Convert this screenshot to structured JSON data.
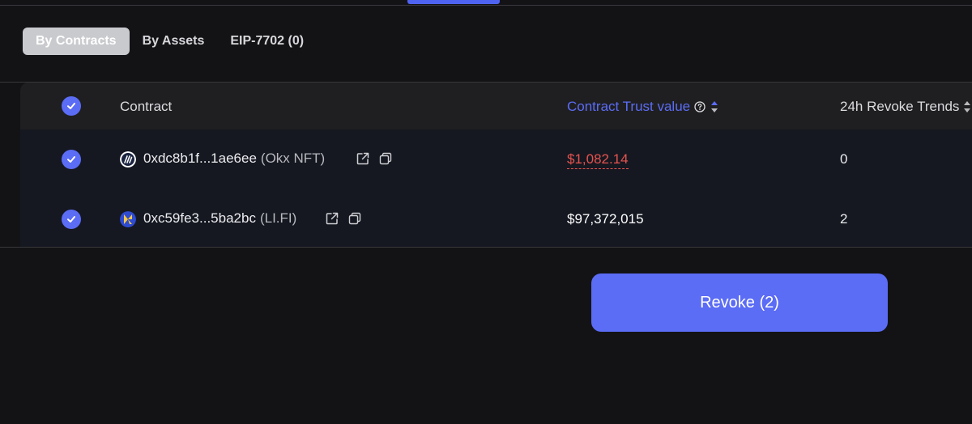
{
  "tabs": [
    {
      "label": "By Contracts",
      "active": true
    },
    {
      "label": "By Assets",
      "active": false
    },
    {
      "label": "EIP-7702 (0)",
      "active": false
    }
  ],
  "table": {
    "headers": {
      "contract": "Contract",
      "trust_value": "Contract Trust value",
      "revoke_trends": "24h Revoke Trends"
    },
    "rows": [
      {
        "checked": true,
        "address": "0xdc8b1f...1ae6ee",
        "tag": "(Okx NFT)",
        "trust_value": "$1,082.14",
        "trust_value_color": "#e6534f",
        "revoke_trend": "0",
        "logo_icon": "okx-nft-logo-icon"
      },
      {
        "checked": true,
        "address": "0xc59fe3...5ba2bc",
        "tag": "(LI.FI)",
        "trust_value": "$97,372,015",
        "trust_value_color": "#ffffff",
        "revoke_trend": "2",
        "logo_icon": "lifi-logo-icon"
      }
    ]
  },
  "revoke_button": {
    "label": "Revoke (2)"
  },
  "colors": {
    "accent": "#5b6cf5",
    "danger": "#e6534f",
    "background": "#131316"
  }
}
